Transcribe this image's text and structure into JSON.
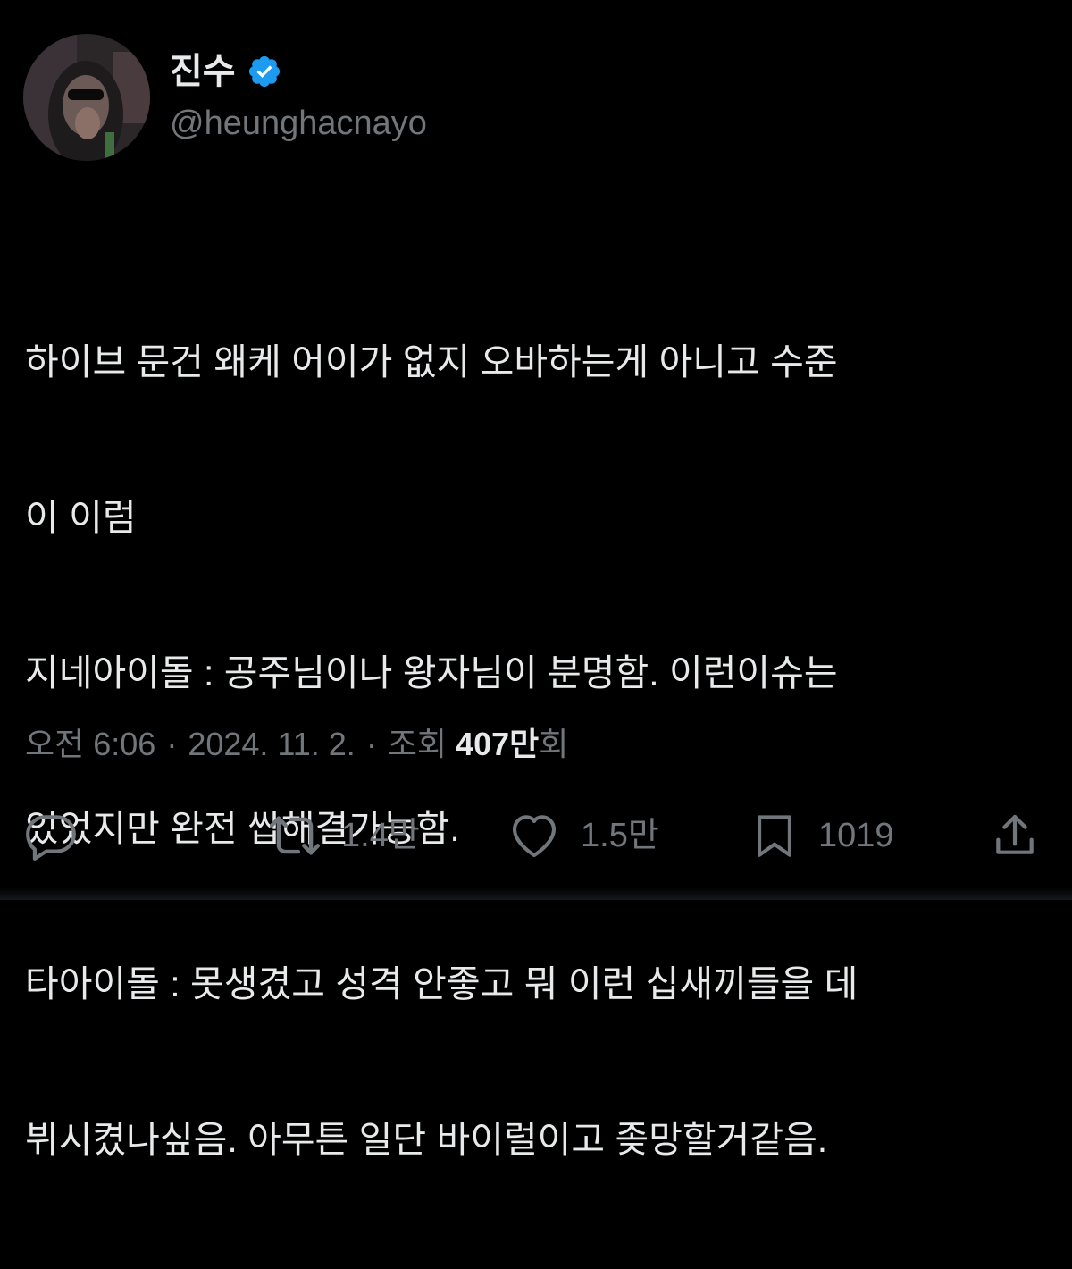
{
  "author": {
    "display_name": "진수",
    "handle": "@heunghacnayo",
    "verified": true,
    "verified_color": "#1d9bf0",
    "avatar_icon": "avatar-photo"
  },
  "tweet": {
    "text_lines": [
      "하이브 문건 왜케 어이가 없지 오바하는게 아니고 수준",
      "이 이럼",
      "지네아이돌 : 공주님이나 왕자님이 분명함. 이런이슈는",
      "있었지만 완전 쌉해결가능함.",
      "타아이돌 : 못생겼고 성격 안좋고 뭐 이런 십새끼들을 데",
      "뷔시켰나싶음. 아무튼 일단 바이럴이고 좆망할거같음."
    ]
  },
  "meta": {
    "time": "오전 6:06",
    "separator": "·",
    "date": "2024. 11. 2.",
    "views_label": "조회",
    "views_number": "407만",
    "views_suffix": "회"
  },
  "actions": {
    "reply": {
      "icon": "reply-icon",
      "count": ""
    },
    "retweet": {
      "icon": "retweet-icon",
      "count": "1.4만"
    },
    "like": {
      "icon": "heart-icon",
      "count": "1.5만"
    },
    "bookmark": {
      "icon": "bookmark-icon",
      "count": "1019"
    },
    "share": {
      "icon": "share-icon",
      "count": ""
    }
  },
  "colors": {
    "background": "#000000",
    "text_primary": "#e7e9ea",
    "text_secondary": "#71767b",
    "accent": "#1d9bf0"
  }
}
